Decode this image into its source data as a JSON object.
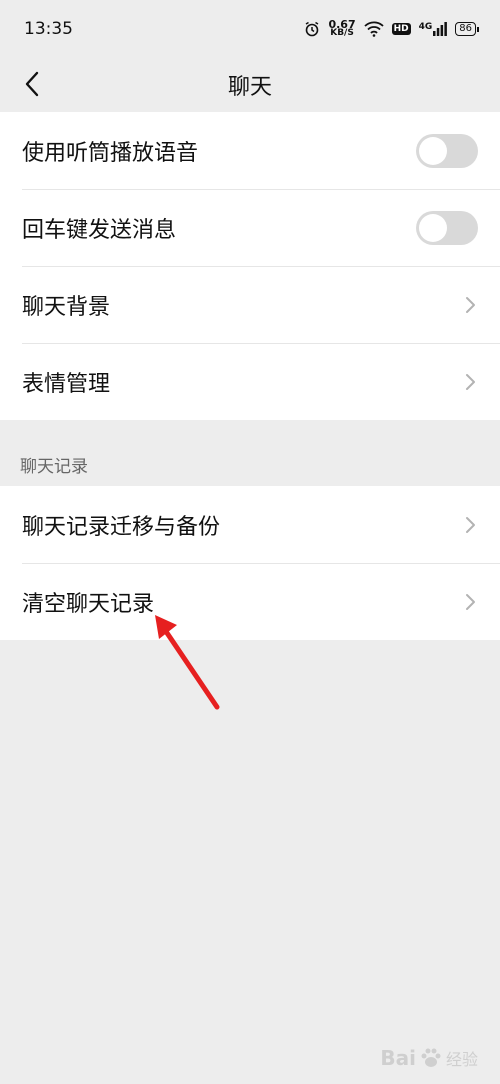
{
  "status_bar": {
    "time": "13:35",
    "net_speed": "0.67",
    "net_unit": "KB/S",
    "hd": "HD",
    "signal_type": "4G",
    "battery": "86"
  },
  "header": {
    "title": "聊天"
  },
  "settings": {
    "items": [
      {
        "label": "使用听筒播放语音",
        "type": "toggle",
        "on": false
      },
      {
        "label": "回车键发送消息",
        "type": "toggle",
        "on": false
      },
      {
        "label": "聊天背景",
        "type": "link"
      },
      {
        "label": "表情管理",
        "type": "link"
      }
    ]
  },
  "chat_history": {
    "section_title": "聊天记录",
    "items": [
      {
        "label": "聊天记录迁移与备份"
      },
      {
        "label": "清空聊天记录"
      }
    ]
  },
  "annotation": {
    "arrow_color": "#e62020"
  },
  "watermark": {
    "brand": "Bai",
    "brand_suffix": "经验"
  }
}
